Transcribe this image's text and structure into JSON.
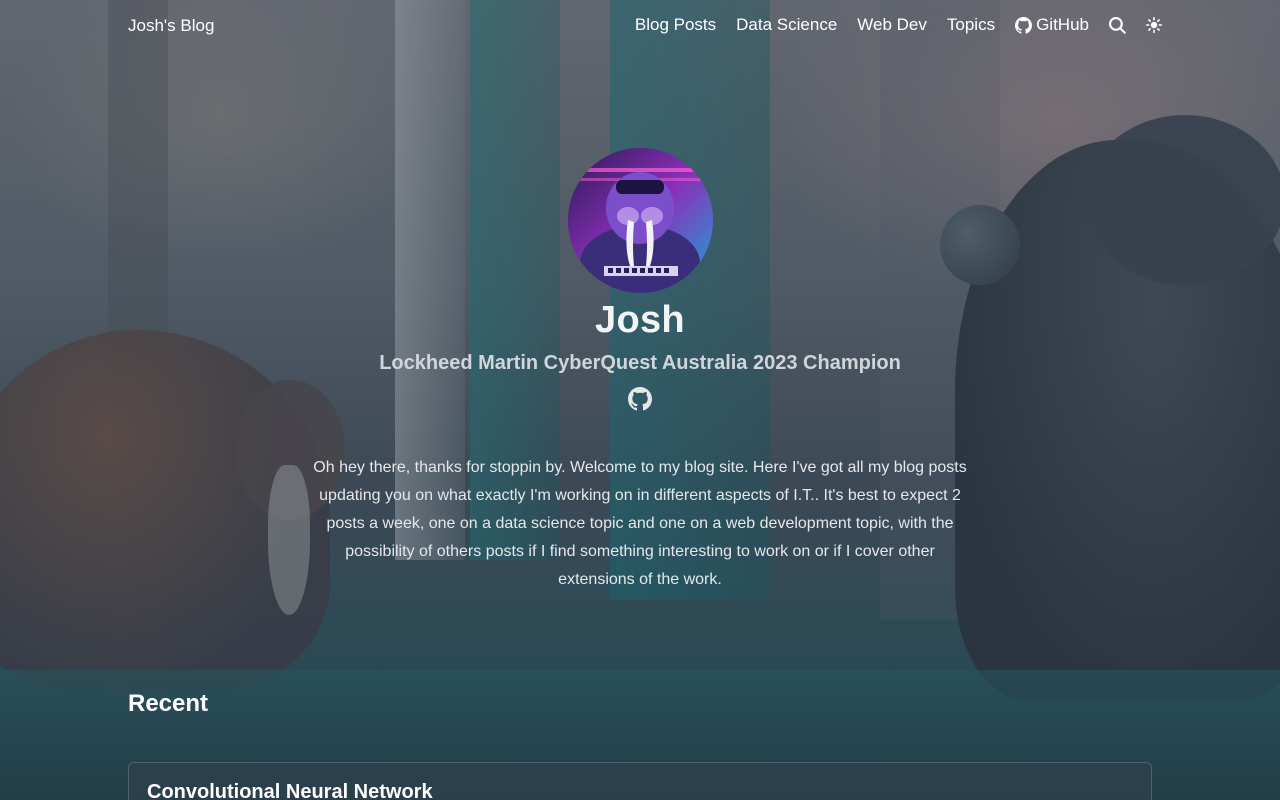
{
  "header": {
    "brand": "Josh's Blog",
    "nav": [
      {
        "label": "Blog Posts"
      },
      {
        "label": "Data Science"
      },
      {
        "label": "Web Dev"
      },
      {
        "label": "Topics"
      },
      {
        "label": "GitHub",
        "icon": "github-icon"
      }
    ],
    "icons": [
      "search-icon",
      "theme-toggle-icon"
    ]
  },
  "profile": {
    "name": "Josh",
    "subtitle": "Lockheed Martin CyberQuest Australia 2023 Champion",
    "social_icon": "github-icon"
  },
  "intro": "Oh hey there, thanks for stoppin by. Welcome to my blog site. Here I've got all my blog posts updating you on what exactly I'm working on in different aspects of I.T.. It's best to expect 2 posts a week, one on a data science topic and one on a web development topic, with the possibility of others posts if I find something interesting to work on or if I cover other extensions of the work.",
  "recent": {
    "heading": "Recent",
    "posts": [
      {
        "title": "Convolutional Neural Network"
      }
    ]
  }
}
